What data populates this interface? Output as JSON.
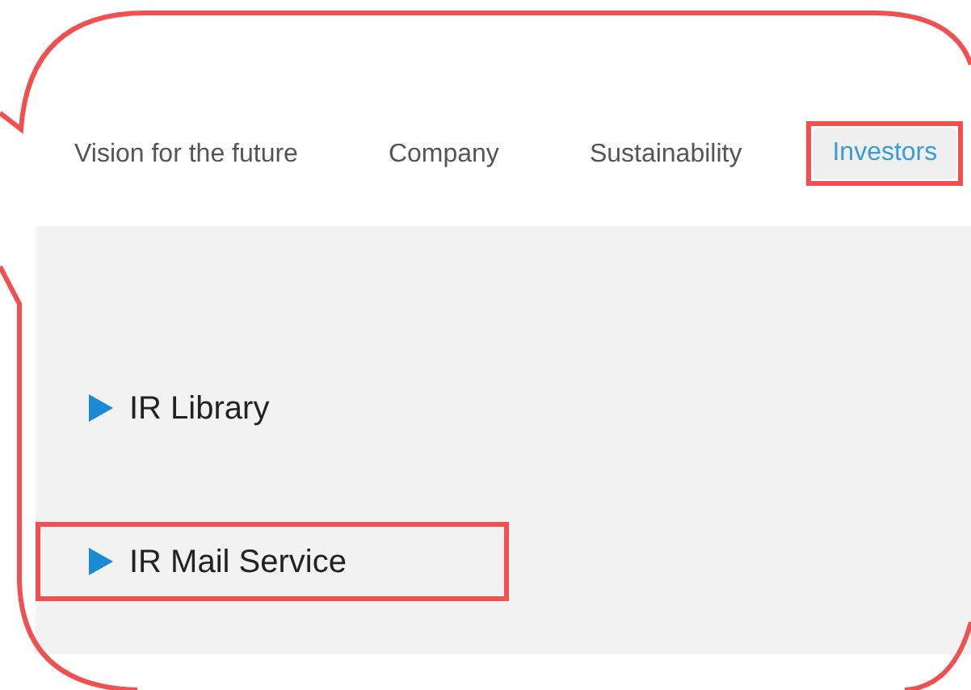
{
  "nav": [
    {
      "label": "Vision for the future",
      "selected": false,
      "highlighted": false
    },
    {
      "label": "Company",
      "selected": false,
      "highlighted": false
    },
    {
      "label": "Sustainability",
      "selected": false,
      "highlighted": false
    },
    {
      "label": "Investors",
      "selected": true,
      "highlighted": true
    }
  ],
  "links": [
    {
      "label": "IR Library",
      "highlighted": false
    },
    {
      "label": "IR Mail Service",
      "highlighted": true
    }
  ]
}
